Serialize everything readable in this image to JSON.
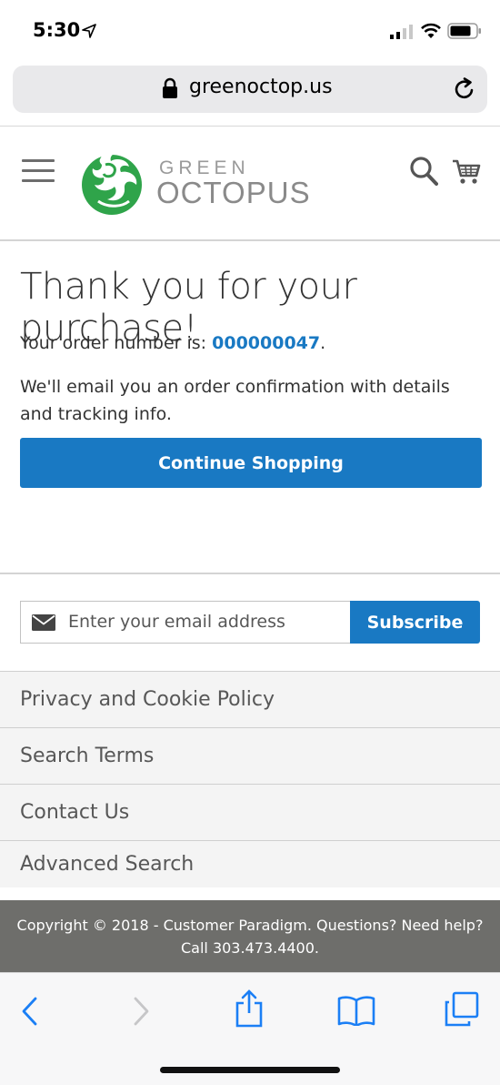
{
  "status_bar": {
    "time": "5:30"
  },
  "browser": {
    "url": "greenoctop.us"
  },
  "header": {
    "logo_line1": "GREEN",
    "logo_line2": "OCTOPUS",
    "icons": [
      "hamburger-menu-icon",
      "search-icon",
      "cart-icon"
    ]
  },
  "main": {
    "title": "Thank you for your purchase!",
    "order_prefix": "Your order number is: ",
    "order_number": "000000047",
    "order_suffix": ".",
    "email_note": "We'll email you an order confirmation with details and tracking info.",
    "continue_label": "Continue Shopping"
  },
  "newsletter": {
    "placeholder": "Enter your email address",
    "subscribe_label": "Subscribe"
  },
  "footer": {
    "links": [
      "Privacy and Cookie Policy",
      "Search Terms",
      "Contact Us",
      "Advanced Search"
    ],
    "copyright_line1": "Copyright © 2018 - Customer Paradigm. Questions? Need help?",
    "copyright_line2": "Call 303.473.4400."
  },
  "colors": {
    "accent": "#1979c3",
    "footer_bg": "#6e6e6b",
    "logo_green": "#2fa44a"
  }
}
